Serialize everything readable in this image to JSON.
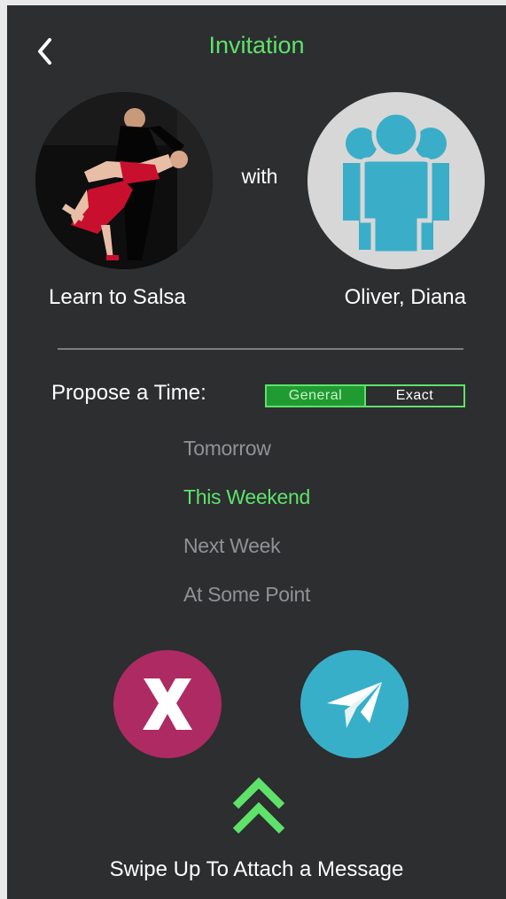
{
  "header": {
    "title": "Invitation",
    "back_icon": "chevron-left-icon"
  },
  "invitation": {
    "event_name": "Learn to Salsa",
    "connector": "with",
    "invitees": "Oliver, Diana",
    "group_icon": "group-people-icon"
  },
  "time": {
    "label": "Propose a Time:",
    "modes": [
      {
        "label": "General",
        "selected": true
      },
      {
        "label": "Exact",
        "selected": false
      }
    ],
    "options": [
      {
        "label": "Tomorrow",
        "selected": false
      },
      {
        "label": "This Weekend",
        "selected": true
      },
      {
        "label": "Next Week",
        "selected": false
      },
      {
        "label": "At Some Point",
        "selected": false
      }
    ]
  },
  "actions": {
    "cancel_icon": "x-icon",
    "send_icon": "paper-plane-icon"
  },
  "footer": {
    "swipe_icon": "double-chevron-up-icon",
    "swipe_text": "Swipe Up To Attach a Message"
  },
  "colors": {
    "background": "#2c2e30",
    "accent_green": "#5fe26a",
    "segment_selected": "#1f9b32",
    "muted_text": "#909295",
    "cancel": "#ad2a62",
    "send": "#38afc9",
    "group_icon": "#3aaec8",
    "group_bg": "#d7d7d8"
  }
}
